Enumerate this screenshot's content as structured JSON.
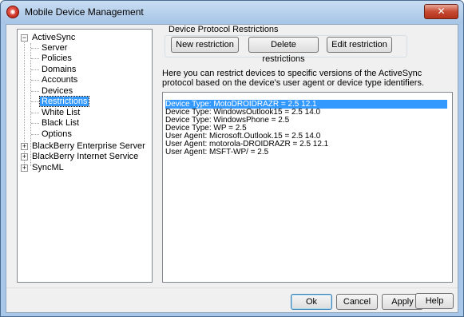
{
  "window": {
    "title": "Mobile Device Management",
    "icon": "mdaemon-app-icon",
    "close_label": "✕"
  },
  "tree": {
    "activesync": "ActiveSync",
    "activesync_children": [
      "Server",
      "Policies",
      "Domains",
      "Accounts",
      "Devices",
      "Restrictions",
      "White List",
      "Black List",
      "Options"
    ],
    "selected": "Restrictions",
    "blackberry_enterprise": "BlackBerry Enterprise Server",
    "blackberry_internet": "BlackBerry Internet Service",
    "syncml": "SyncML"
  },
  "group": {
    "title": "Device Protocol Restrictions",
    "new_label": "New restriction",
    "delete_label": "Delete restrictions",
    "edit_label": "Edit restriction"
  },
  "description": "Here you can restrict devices to specific versions of the ActiveSync protocol based on the device's user agent or device type identifiers.",
  "restrictions": [
    "Device Type: MotoDROIDRAZR = 2.5 12.1",
    "Device Type: WindowsOutlook15 = 2.5 14.0",
    "Device Type: WindowsPhone = 2.5",
    "Device Type: WP = 2.5",
    "User Agent: Microsoft.Outlook.15 = 2.5 14.0",
    "User Agent: motorola-DROIDRAZR = 2.5 12.1",
    "User Agent: MSFT-WP/ = 2.5"
  ],
  "selected_restriction": 0,
  "footer": {
    "ok_label": "Ok",
    "cancel_label": "Cancel",
    "apply_label": "Apply",
    "help_label": "Help"
  }
}
